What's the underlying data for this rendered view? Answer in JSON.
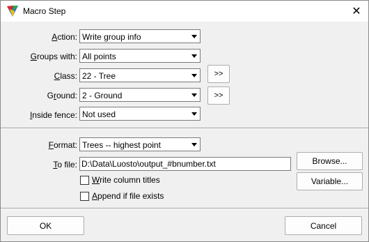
{
  "window": {
    "title": "Macro Step",
    "close_glyph": "✕"
  },
  "form": {
    "action_label": "Action:",
    "action_accel": "A",
    "action_value": "Write group info",
    "groups_label": "Groups with:",
    "groups_accel": "G",
    "groups_value": "All points",
    "class_label": "Class:",
    "class_accel": "C",
    "class_value": "22 - Tree",
    "class_more": ">>",
    "ground_label": "Ground:",
    "ground_accel": "r",
    "ground_value": "2 - Ground",
    "ground_more": ">>",
    "fence_label": "Inside fence:",
    "fence_accel": "I",
    "fence_value": "Not used"
  },
  "output": {
    "format_label": "Format:",
    "format_accel": "F",
    "format_value": "Trees -- highest point",
    "tofile_label": "To file:",
    "tofile_accel": "T",
    "tofile_value": "D:\\Data\\Luosto\\output_#bnumber.txt",
    "browse_label": "Browse...",
    "variable_label": "Variable...",
    "write_titles_label": "Write column titles",
    "write_titles_accel": "W",
    "write_titles_checked": false,
    "append_label": "Append if file exists",
    "append_accel": "A",
    "append_checked": false
  },
  "footer": {
    "ok_label": "OK",
    "cancel_label": "Cancel"
  }
}
